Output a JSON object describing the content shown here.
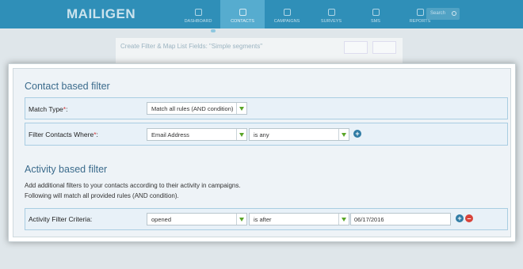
{
  "app": {
    "logo": "MAILIGEN",
    "nav": [
      {
        "label": "DASHBOARD",
        "icon": "home-icon"
      },
      {
        "label": "CONTACTS",
        "icon": "contacts-icon",
        "active": true
      },
      {
        "label": "CAMPAIGNS",
        "icon": "envelope-icon"
      },
      {
        "label": "SURVEYS",
        "icon": "checkbox-icon"
      },
      {
        "label": "SMS",
        "icon": "phone-icon"
      },
      {
        "label": "REPORTS",
        "icon": "chart-icon"
      }
    ],
    "search_placeholder": "Search",
    "background_title": "Create Filter & Map List Fields: \"Simple segments\""
  },
  "contact_filter": {
    "title": "Contact based filter",
    "match_type": {
      "label": "Match Type",
      "required_mark": "*",
      "colon": ":",
      "value": "Match all rules (AND condition)"
    },
    "filter_where": {
      "label": "Filter Contacts Where",
      "required_mark": "*",
      "colon": ":",
      "field_value": "Email Address",
      "condition_value": "is any"
    }
  },
  "activity_filter": {
    "title": "Activity based filter",
    "description_line1": "Add additional filters to your contacts according to their activity in campaigns.",
    "description_line2": "Following will match all provided rules (AND condition).",
    "criteria": {
      "label": "Activity Filter Criteria:",
      "action_value": "opened",
      "condition_value": "is after",
      "date_value": "06/17/2016"
    }
  },
  "colors": {
    "accent": "#2f8fb8",
    "section_title": "#3b6b8c",
    "row_border": "#a9cde2",
    "dropdown_arrow": "#5aa628",
    "required": "#d13a3a"
  }
}
